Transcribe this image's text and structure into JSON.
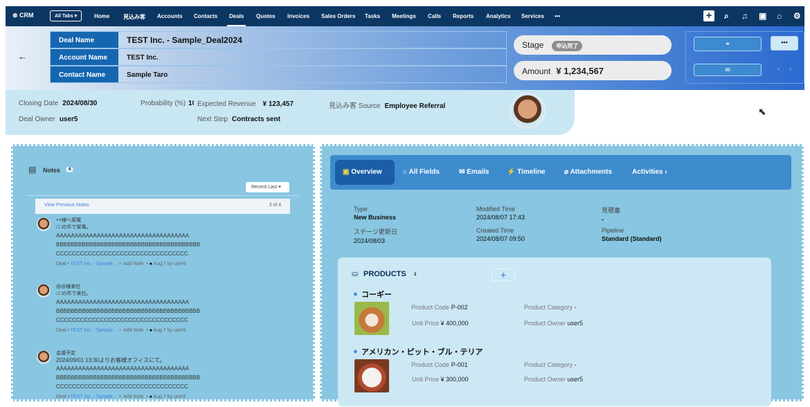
{
  "nav": {
    "logo": "CRM",
    "all_tabs": "All Tabs",
    "tabs": [
      "Home",
      "見込み客",
      "Accounts",
      "Contacts",
      "Deals",
      "Quotes",
      "Invoices",
      "Sales Orders",
      "Tasks",
      "Meetings",
      "Calls",
      "Reports",
      "Analytics",
      "Services",
      "•••"
    ],
    "active": "Deals",
    "icons": [
      "plus-icon",
      "search-icon",
      "bell-icon",
      "calendar-icon",
      "marketplace-icon",
      "settings-icon"
    ]
  },
  "header": {
    "fields": [
      {
        "label": "Deal Name",
        "value": "TEST Inc. - Sample_Deal2024"
      },
      {
        "label": "Account Name",
        "value": "TEST Inc."
      },
      {
        "label": "Contact Name",
        "value": "Sample Taro"
      }
    ],
    "stage_label": "Stage",
    "stage_value": "申込完了",
    "amount_label": "Amount",
    "amount_value": "¥ 1,234,567",
    "more": "•••"
  },
  "info": {
    "closing_date_label": "Closing Date",
    "closing_date": "2024/08/30",
    "probability_label": "Probability (%)",
    "probability": "10",
    "expected_revenue_label": "Expected Revenue",
    "expected_revenue": "¥ 123,457",
    "source_label": "見込み客 Source",
    "source": "Employee Referral",
    "owner_label": "Deal Owner",
    "owner": "user5",
    "next_step_label": "Next Step",
    "next_step": "Contracts sent"
  },
  "notes": {
    "title": "Notes",
    "count": "4",
    "sort": "Recent Last",
    "view_previous": "View Previous Notes",
    "pager": "3 of 4",
    "items": [
      {
        "title": "××様へ架電",
        "line1": "□□の件で架電。",
        "a": "AAAAAAAAAAAAAAAAAAAAAAAAAAAAAAAAAAAA",
        "b": "BBBBBBBBBBBBBBBBBBBBBBBBBBBBBBBBBBBBBBB",
        "c": "CCCCCCCCCCCCCCCCCCCCCCCCCCCCCCCCC",
        "deal": "Deal",
        "link": "TEST Inc. - Sample...",
        "add": "Add Note",
        "time": "Aug 7",
        "by": "by",
        "user": "user5"
      },
      {
        "title": "@@様来社",
        "line1": "□□の件で来社。",
        "a": "AAAAAAAAAAAAAAAAAAAAAAAAAAAAAAAAAAAA",
        "b": "BBBBBBBBBBBBBBBBBBBBBBBBBBBBBBBBBBBBBBB",
        "c": "CCCCCCCCCCCCCCCCCCCCCCCCCCCCCCCCC",
        "deal": "Deal",
        "link": "TEST Inc. - Sample...",
        "add": "Add Note",
        "time": "Aug 7",
        "by": "by",
        "user": "user5"
      },
      {
        "title": "会議予定",
        "line1": "2024/09/01 13:30よりお客様オフィスにて。",
        "a": "AAAAAAAAAAAAAAAAAAAAAAAAAAAAAAAAAAAA",
        "b": "BBBBBBBBBBBBBBBBBBBBBBBBBBBBBBBBBBBBBBB",
        "c": "CCCCCCCCCCCCCCCCCCCCCCCCCCCCCCCCC",
        "deal": "Deal",
        "link": "TEST Inc. - Sample...",
        "add": "Add Note",
        "time": "Aug 7",
        "by": "by",
        "user": "user5"
      }
    ]
  },
  "tabs": [
    "Overview",
    "All Fields",
    "Emails",
    "Timeline",
    "Attachments",
    "Activities"
  ],
  "overview": {
    "type_label": "Type",
    "type": "New Business",
    "modified_label": "Modified Time",
    "modified": "2024/08/07 17:43",
    "quote_label": "見積書",
    "quote": "-",
    "stage_date_label": "ステージ更新日",
    "stage_date": "2024/08/03",
    "created_label": "Created Time",
    "created": "2024/08/07 09:50",
    "pipeline_label": "Pipeline",
    "pipeline": "Standard (Standard)"
  },
  "products": {
    "title": "PRODUCTS",
    "count": "2",
    "add": "+",
    "code_label": "Product Code",
    "price_label": "Unit Price",
    "category_label": "Product Category",
    "owner_label": "Product Owner",
    "items": [
      {
        "name": "コーギー",
        "code": "P-002",
        "price": "¥ 400,000",
        "category": "-",
        "owner": "user5"
      },
      {
        "name": "アメリカン・ピット・ブル・テリア",
        "code": "P-001",
        "price": "¥ 300,000",
        "category": "-",
        "owner": "user5"
      }
    ]
  }
}
